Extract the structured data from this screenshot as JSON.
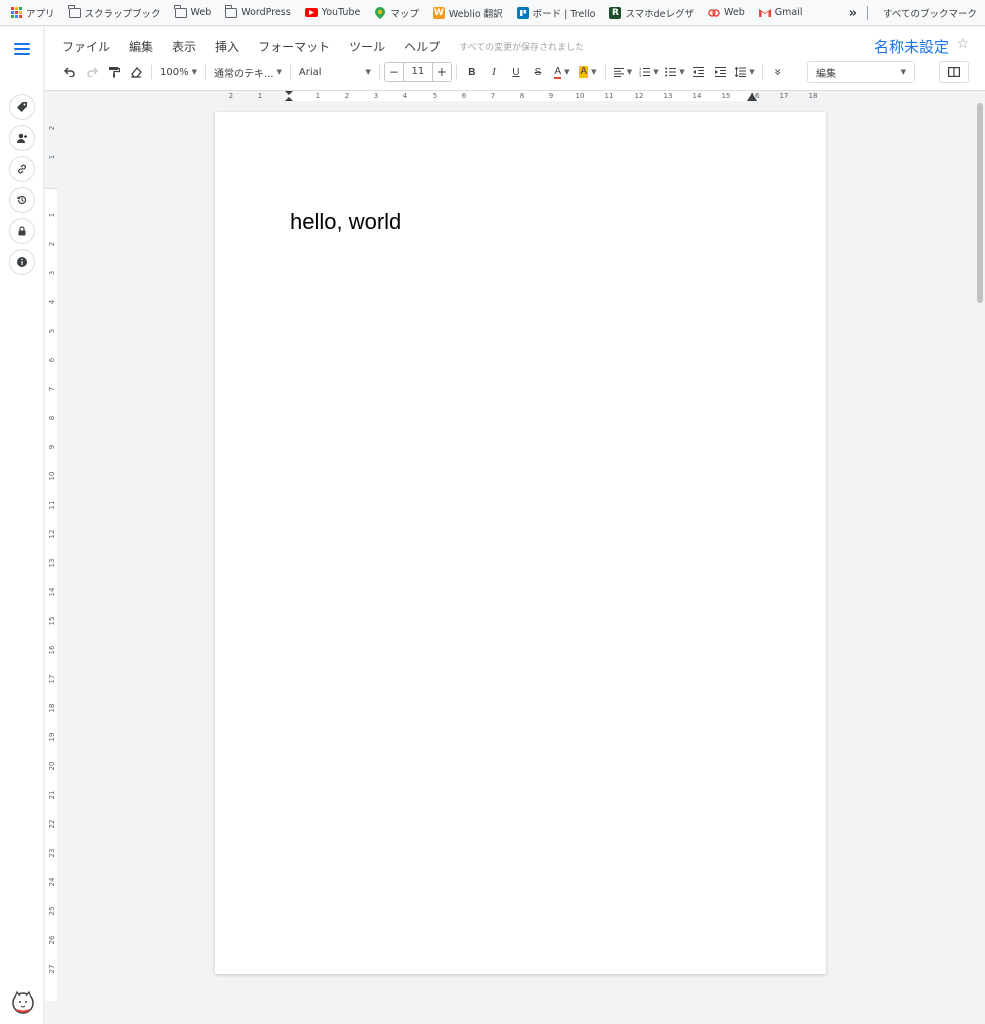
{
  "bookmarks": {
    "items": [
      {
        "label": "アプリ",
        "icon": "apps-grid-icon",
        "color": "#ea4335"
      },
      {
        "label": "スクラップブック",
        "icon": "folder-icon"
      },
      {
        "label": "Web",
        "icon": "folder-icon"
      },
      {
        "label": "WordPress",
        "icon": "folder-icon"
      },
      {
        "label": "YouTube",
        "icon": "youtube-icon",
        "color": "#ff0000"
      },
      {
        "label": "マップ",
        "icon": "maps-pin-icon",
        "color": "#34a853"
      },
      {
        "label": "Weblio 翻訳",
        "icon": "weblio-icon",
        "color": "#f29b1d"
      },
      {
        "label": "ボード | Trello",
        "icon": "trello-icon",
        "color": "#0079bf"
      },
      {
        "label": "スマホdeレグザ",
        "icon": "regza-icon",
        "color": "#1e4d2b"
      },
      {
        "label": "Web",
        "icon": "web-circles-icon",
        "color": "#ea4335"
      },
      {
        "label": "Gmail",
        "icon": "gmail-icon",
        "color": "#ea4335"
      }
    ],
    "overflow": "»",
    "all_bookmarks": "すべてのブックマーク"
  },
  "menu": {
    "items": [
      "ファイル",
      "編集",
      "表示",
      "挿入",
      "フォーマット",
      "ツール",
      "ヘルプ"
    ],
    "saved_status": "すべての変更が保存されました"
  },
  "document": {
    "title": "名称未設定",
    "star": "☆",
    "body_text": "hello, world"
  },
  "toolbar": {
    "zoom": "100%",
    "style": "通常のテキ...",
    "font": "Arial",
    "font_size": "11",
    "minus": "−",
    "plus": "+",
    "bold": "B",
    "italic": "I",
    "underline": "U",
    "strike": "S",
    "text_color": "A",
    "highlight": "A",
    "more": "»",
    "mode": "編集"
  },
  "ruler": {
    "h_labels": [
      "2",
      "1",
      "1",
      "2",
      "3",
      "4",
      "5",
      "6",
      "7",
      "8",
      "9",
      "10",
      "11",
      "12",
      "13",
      "14",
      "15",
      "16",
      "17",
      "18"
    ],
    "v_labels": [
      "2",
      "1",
      "1",
      "2",
      "3",
      "4",
      "5",
      "6",
      "7",
      "8",
      "9",
      "10",
      "11",
      "12",
      "13",
      "14",
      "15",
      "16",
      "17",
      "18",
      "19",
      "20",
      "21",
      "22",
      "23",
      "24",
      "25",
      "26",
      "27"
    ]
  },
  "sidebar": {
    "buttons": [
      "tag-icon",
      "add-person-icon",
      "link-icon",
      "history-icon",
      "lock-icon",
      "info-icon"
    ]
  },
  "colors": {
    "accent": "#1a73e8",
    "text_color_underline": "#ea4335",
    "highlight_yellow": "#fbbc04"
  }
}
